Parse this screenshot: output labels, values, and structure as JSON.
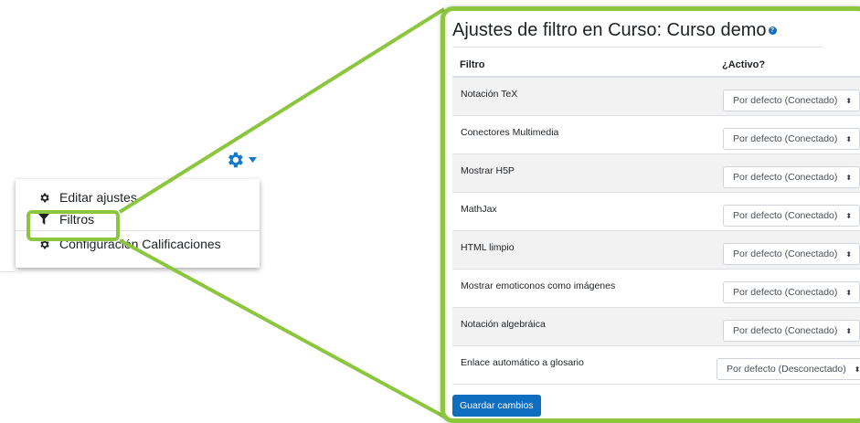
{
  "menu": {
    "items": [
      {
        "label": "Editar ajustes",
        "icon": "gear-icon"
      },
      {
        "label": "Filtros",
        "icon": "filter-icon"
      },
      {
        "label": "Configuración Calificaciones",
        "icon": "gear-icon"
      }
    ]
  },
  "panel": {
    "title": "Ajustes de filtro en Curso: Curso demo",
    "help_icon": "question-circle-icon",
    "columns": {
      "filter": "Filtro",
      "active": "¿Activo?"
    },
    "rows": [
      {
        "name": "Notación TeX",
        "value": "Por defecto (Conectado)"
      },
      {
        "name": "Conectores Multimedia",
        "value": "Por defecto (Conectado)"
      },
      {
        "name": "Mostrar H5P",
        "value": "Por defecto (Conectado)"
      },
      {
        "name": "MathJax",
        "value": "Por defecto (Conectado)"
      },
      {
        "name": "HTML limpio",
        "value": "Por defecto (Conectado)"
      },
      {
        "name": "Mostrar emoticonos como imágenes",
        "value": "Por defecto (Conectado)"
      },
      {
        "name": "Notación algebráica",
        "value": "Por defecto (Conectado)"
      },
      {
        "name": "Enlace automático a glosario",
        "value": "Por defecto (Desconectado)"
      }
    ],
    "save_label": "Guardar cambios"
  },
  "colors": {
    "highlight": "#8cc63f",
    "primary": "#0f6cbf",
    "gear": "#1177d1"
  }
}
